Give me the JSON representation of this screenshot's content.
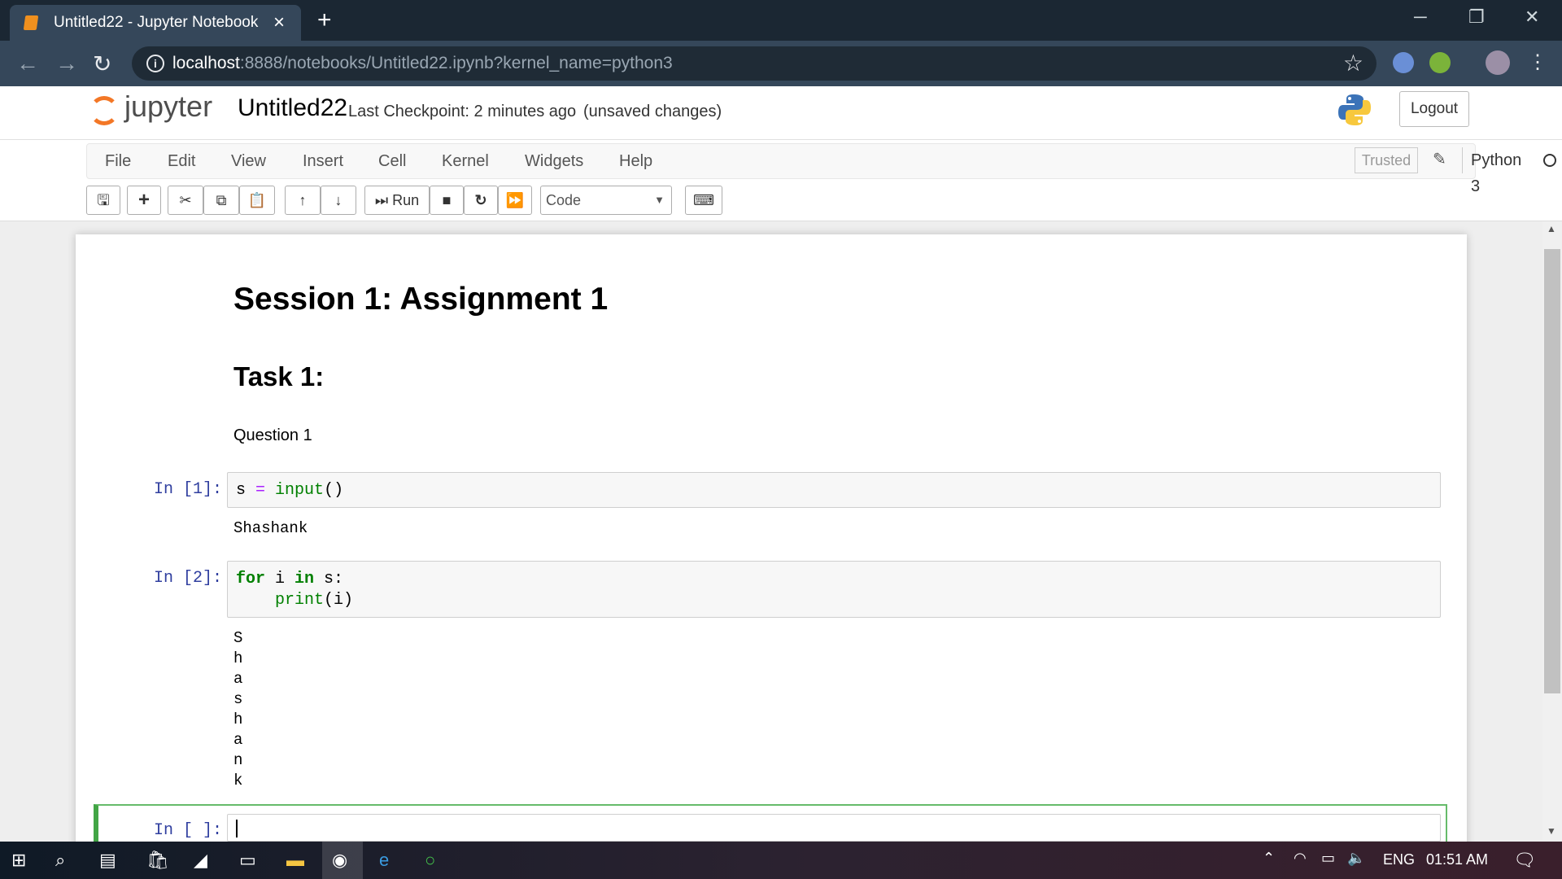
{
  "browser": {
    "tab_title": "Untitled22 - Jupyter Notebook",
    "url_host": "localhost",
    "url_path": ":8888/notebooks/Untitled22.ipynb?kernel_name=python3"
  },
  "header": {
    "logo_text": "jupyter",
    "notebook_name": "Untitled22",
    "checkpoint": "Last Checkpoint: 2 minutes ago",
    "unsaved": "(unsaved changes)",
    "logout": "Logout"
  },
  "menu": {
    "items": [
      "File",
      "Edit",
      "View",
      "Insert",
      "Cell",
      "Kernel",
      "Widgets",
      "Help"
    ],
    "trusted": "Trusted",
    "kernel": "Python 3"
  },
  "toolbar": {
    "run_label": "Run",
    "cell_type": "Code"
  },
  "notebook": {
    "title": "Session 1: Assignment 1",
    "task": "Task 1:",
    "question": "Question 1",
    "cells": [
      {
        "prompt": "In [1]:",
        "code": [
          "s = input()"
        ],
        "output": [
          "Shashank"
        ]
      },
      {
        "prompt": "In [2]:",
        "code": [
          "for i in s:",
          "    print(i)"
        ],
        "output": [
          "S",
          "h",
          "a",
          "s",
          "h",
          "a",
          "n",
          "k"
        ]
      },
      {
        "prompt": "In [ ]:",
        "code": [
          ""
        ]
      }
    ]
  },
  "taskbar": {
    "lang": "ENG",
    "time": "01:51 AM"
  },
  "colors": {
    "jupyter_orange": "#f37726",
    "prompt_blue": "#303f9f",
    "keyword_green": "#008000",
    "selected_cell_green": "#42a545"
  }
}
